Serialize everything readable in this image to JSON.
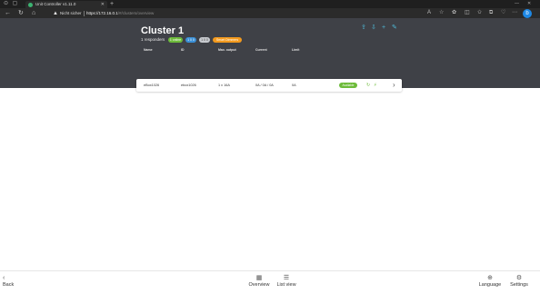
{
  "browser": {
    "tab_title": "Unit Controller v1.11.0",
    "new_tab": "+",
    "window_controls": [
      "—",
      "✕"
    ],
    "not_secure": "Nicht sicher",
    "url_host": "https://172.16.0.1",
    "url_path": "/#/clusters/overview",
    "profile_initial": "b"
  },
  "cluster": {
    "title": "Cluster 1",
    "responders": "1 responders",
    "badges": [
      {
        "label": "1 online",
        "color": "#6dbb3a"
      },
      {
        "label": "1 0 0",
        "color": "#3a8fd6"
      },
      {
        "label": "1 0 0",
        "color": "#c8cbd0"
      },
      {
        "label": "Smart Dimmers",
        "color": "#f39a1e"
      }
    ]
  },
  "table": {
    "columns": [
      "Name",
      "ID",
      "Max. output",
      "Current",
      "Limit"
    ],
    "rows": [
      {
        "name": "eBox1026",
        "id": "ebox1026",
        "max_output": "1 x 16A",
        "current": "0A / 0A / 0A",
        "limit": "0A",
        "status": "Available"
      }
    ]
  },
  "bottom_nav": {
    "back": "Back",
    "overview": "Overview",
    "list_view": "List view",
    "language": "Language",
    "settings": "Settings"
  }
}
